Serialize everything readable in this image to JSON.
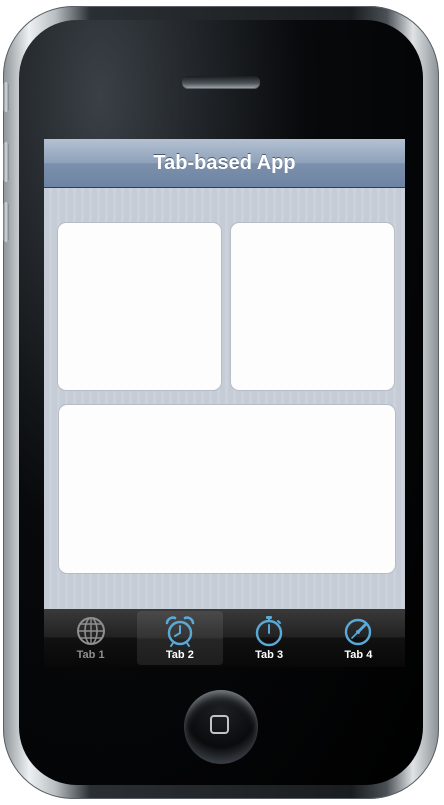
{
  "navbar": {
    "title": "Tab-based App"
  },
  "tabs": [
    {
      "label": "Tab 1",
      "icon": "globe-icon",
      "color": "#8f8f8f"
    },
    {
      "label": "Tab 2",
      "icon": "alarm-clock-icon",
      "color": "#5aa9d6"
    },
    {
      "label": "Tab 3",
      "icon": "stopwatch-icon",
      "color": "#5aa9d6"
    },
    {
      "label": "Tab 4",
      "icon": "timer-icon",
      "color": "#5aa9d6"
    }
  ],
  "colors": {
    "navbar": "#7b90ab",
    "content_background": "#c5ccd6",
    "tab_icon_active": "#5aa9d6"
  }
}
